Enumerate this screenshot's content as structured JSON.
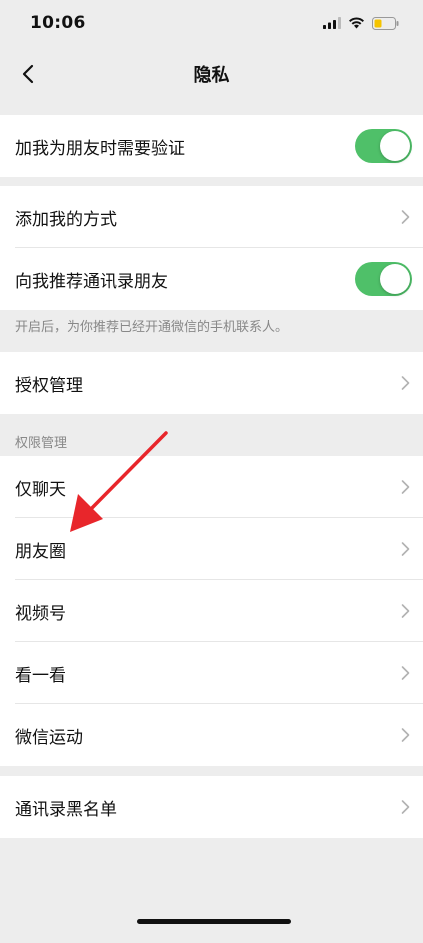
{
  "status_bar": {
    "time": "10:06"
  },
  "nav": {
    "title": "隐私"
  },
  "group1": {
    "verify_label": "加我为朋友时需要验证",
    "verify_on": true
  },
  "group2": {
    "add_me_label": "添加我的方式",
    "recommend_label": "向我推荐通讯录朋友",
    "recommend_on": true,
    "hint": "开启后，为你推荐已经开通微信的手机联系人。"
  },
  "group3": {
    "auth_label": "授权管理"
  },
  "permissions": {
    "section_title": "权限管理",
    "items": [
      {
        "label": "仅聊天"
      },
      {
        "label": "朋友圈"
      },
      {
        "label": "视频号"
      },
      {
        "label": "看一看"
      },
      {
        "label": "微信运动"
      }
    ]
  },
  "group5": {
    "blacklist_label": "通讯录黑名单"
  },
  "colors": {
    "toggle_on": "#4fc069",
    "annotation_arrow": "#e8262b"
  }
}
